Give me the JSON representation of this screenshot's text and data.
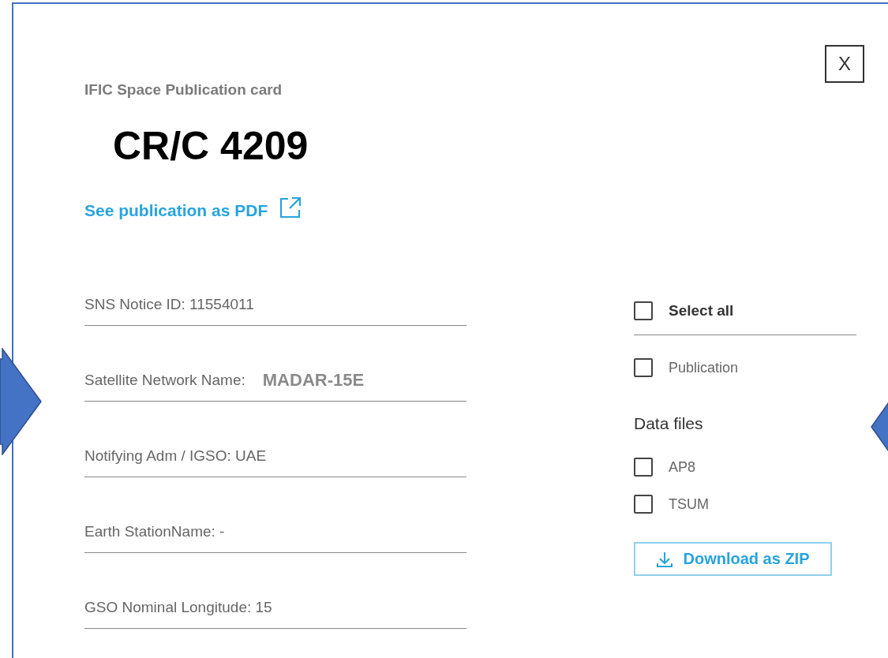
{
  "card": {
    "title": "IFIC Space Publication card",
    "heading": "CR/C 4209",
    "close_label": "X",
    "pdf_link": "See publication as PDF"
  },
  "fields": [
    {
      "text": "SNS Notice ID: 11554011"
    },
    {
      "text": "Satellite Network Name:",
      "value": "MADAR-15E"
    },
    {
      "text": "Notifying Adm / IGSO: UAE"
    },
    {
      "text": "Earth StationName: -"
    },
    {
      "text": "GSO Nominal Longitude:  15"
    }
  ],
  "select_all": {
    "label": "Select all",
    "checked": false
  },
  "publication": {
    "label": "Publication",
    "checked": false
  },
  "data_files": {
    "heading": "Data files",
    "items": [
      {
        "label": "AP8",
        "checked": false
      },
      {
        "label": "TSUM",
        "checked": false
      }
    ]
  },
  "download_button": "Download as ZIP"
}
